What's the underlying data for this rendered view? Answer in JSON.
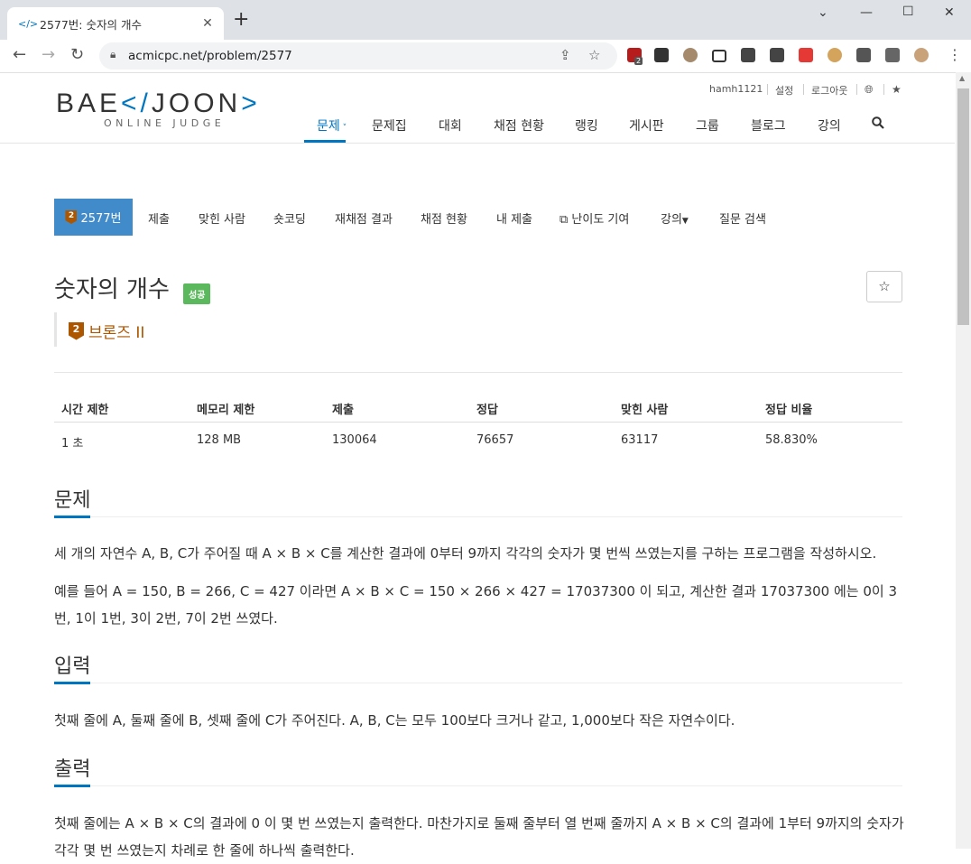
{
  "browser": {
    "tab_title": "2577번: 숫자의 개수",
    "tab_favicon": "</>",
    "url": "acmicpc.net/problem/2577",
    "extension_badge": "2"
  },
  "site": {
    "logo": {
      "part1": "BAE",
      "part2": "</",
      "part3": "JOON",
      "part4": ">",
      "subtitle": "ONLINE JUDGE"
    },
    "top_menu": [
      "hamh1121",
      "설정",
      "로그아웃"
    ],
    "main_nav": [
      "문제",
      "문제집",
      "대회",
      "채점 현황",
      "랭킹",
      "게시판",
      "그룹",
      "블로그",
      "강의"
    ]
  },
  "problem_tabs": {
    "active": "2577번",
    "badge": "2",
    "items": [
      "제출",
      "맞힌 사람",
      "숏코딩",
      "재채점 결과",
      "채점 현황",
      "내 제출",
      "난이도 기여",
      "강의",
      "질문 검색"
    ]
  },
  "problem": {
    "title": "숫자의 개수",
    "status_label": "성공",
    "tier_badge": "2",
    "tier": "브론즈 II",
    "star": "☆"
  },
  "info_table": {
    "headers": [
      "시간 제한",
      "메모리 제한",
      "제출",
      "정답",
      "맞힌 사람",
      "정답 비율"
    ],
    "values": [
      "1 초",
      "128 MB",
      "130064",
      "76657",
      "63117",
      "58.830%"
    ]
  },
  "sections": {
    "problem_head": "문제",
    "problem_p1": "세 개의 자연수 A, B, C가 주어질 때 A × B × C를 계산한 결과에 0부터 9까지 각각의 숫자가 몇 번씩 쓰였는지를 구하는 프로그램을 작성하시오.",
    "problem_p2": "예를 들어 A = 150, B = 266, C = 427 이라면 A × B × C = 150 × 266 × 427 = 17037300 이 되고, 계산한 결과 17037300 에는 0이 3번, 1이 1번, 3이 2번, 7이 2번 쓰였다.",
    "input_head": "입력",
    "input_p": "첫째 줄에 A, 둘째 줄에 B, 셋째 줄에 C가 주어진다. A, B, C는 모두 100보다 크거나 같고, 1,000보다 작은 자연수이다.",
    "output_head": "출력",
    "output_p": "첫째 줄에는 A × B × C의 결과에 0 이 몇 번 쓰였는지 출력한다. 마찬가지로 둘째 줄부터 열 번째 줄까지 A × B × C의 결과에 1부터 9까지의 숫자가 각각 몇 번 쓰였는지 차례로 한 줄에 하나씩 출력한다."
  },
  "colors": {
    "accent": "#0076c0",
    "tab_active": "#428bca",
    "success": "#5cb85c",
    "bronze": "#ad5600"
  }
}
